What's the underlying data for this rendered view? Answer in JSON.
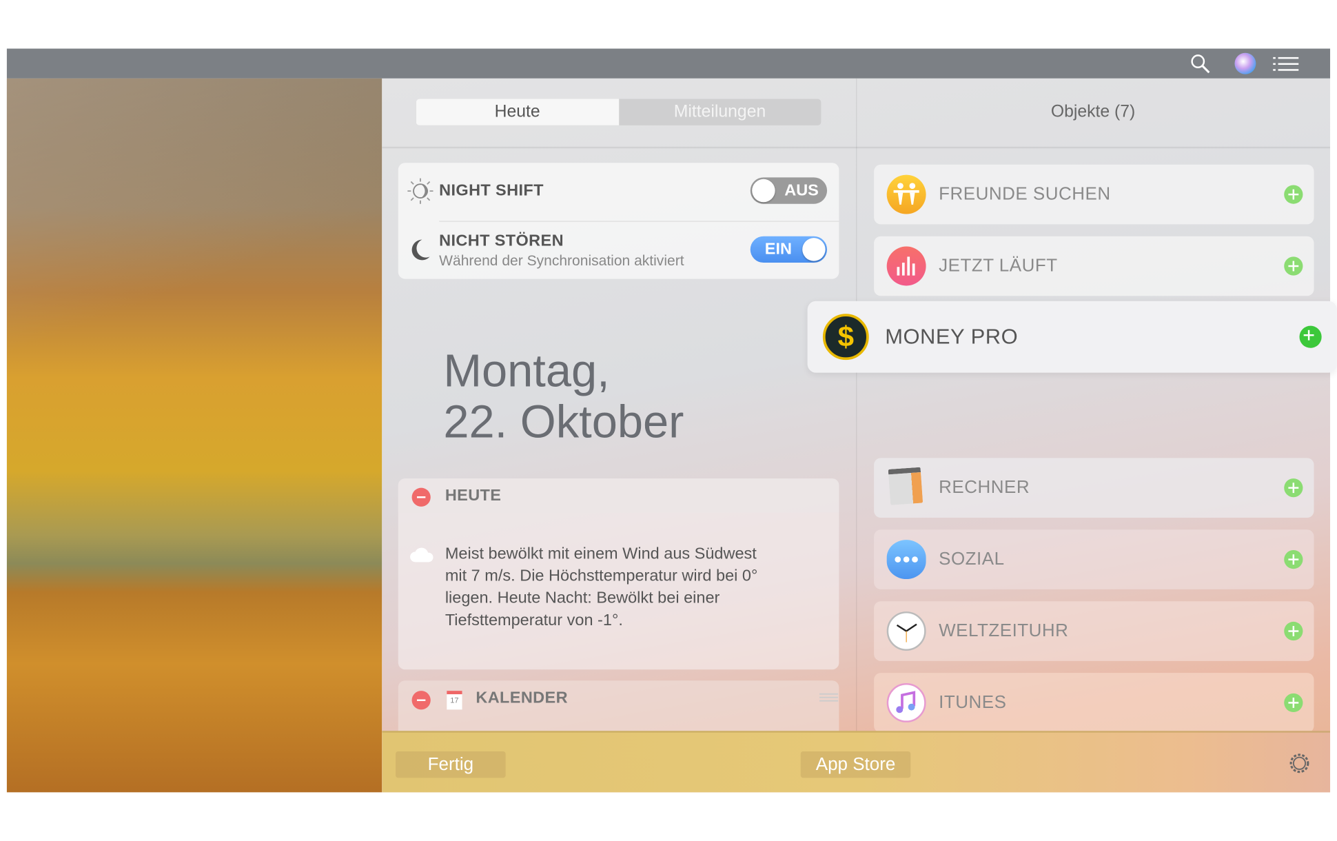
{
  "menubar": {
    "icons": [
      "search-icon",
      "siri-icon",
      "notification-center-icon"
    ]
  },
  "tabs": {
    "today": "Heute",
    "notifications": "Mitteilungen",
    "active": "Heute"
  },
  "objects_header": "Objekte (7)",
  "controls": {
    "night_shift": {
      "label": "NIGHT SHIFT",
      "state": "AUS",
      "on": false
    },
    "do_not_disturb": {
      "label": "NICHT STÖREN",
      "subtitle": "Während der Synchronisation aktiviert",
      "state": "EIN",
      "on": true
    }
  },
  "date": {
    "line1": "Montag,",
    "line2": "22. Oktober"
  },
  "widgets": [
    {
      "title": "HEUTE",
      "lines": [
        "Meist bewölkt mit einem Wind aus Südwest",
        "mit 7 m/s. Die Höchsttemperatur wird bei 0°",
        "liegen. Heute Nacht: Bewölkt bei einer",
        "Tiefsttemperatur von -1°."
      ]
    },
    {
      "title": "KALENDER",
      "icon_text": "17"
    }
  ],
  "items": [
    {
      "label": "FREUNDE SUCHEN",
      "icon": "find-friends-icon",
      "color": "#f7b52a"
    },
    {
      "label": "JETZT LÄUFT",
      "icon": "now-playing-icon",
      "color": "#f5677a"
    },
    {
      "label": "MONEY PRO",
      "icon": "money-pro-icon",
      "color": "#f2c200"
    },
    {
      "label": "RECHNER",
      "icon": "calculator-icon",
      "color": "#888888"
    },
    {
      "label": "SOZIAL",
      "icon": "social-icon",
      "color": "#5aa9f5"
    },
    {
      "label": "WELTZEITUHR",
      "icon": "world-clock-icon",
      "color": "#ffffff"
    },
    {
      "label": "ITUNES",
      "icon": "itunes-icon",
      "color": "#e56ac0"
    }
  ],
  "bottom": {
    "done": "Fertig",
    "app_store": "App Store"
  },
  "colors": {
    "toggle_on": "#5b9ff5",
    "add": "#8bdc72",
    "remove": "#f06a6a"
  }
}
